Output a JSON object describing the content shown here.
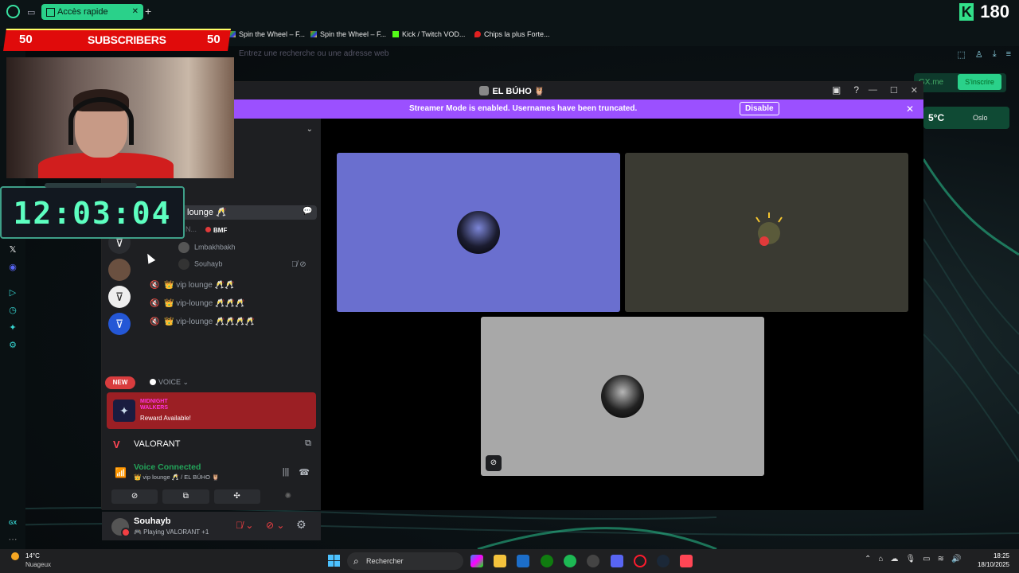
{
  "browser": {
    "tab_label": "Accès rapide",
    "counter": "180",
    "address_placeholder": "Entrez une recherche ou une adresse web",
    "bookmarks": [
      "Spin the Wheel – F...",
      "Spin the Wheel – F...",
      "Kick / Twitch VOD...",
      "Chips la plus Forte..."
    ],
    "gxme": "GX.me",
    "subscribe_label": "S'inscrire",
    "weather_temp": "5°C",
    "weather_city": "Oslo",
    "sidebar_label": "GX"
  },
  "overlay": {
    "subs_left": "50",
    "subs_label": "SUBSCRIBERS",
    "subs_right": "50",
    "timer": "12:03:04"
  },
  "discord": {
    "window_title": "EL BÚHO 🦉",
    "streamer_message": "Streamer Mode is enabled. Usernames have been truncated.",
    "disable_label": "Disable",
    "new_badge": "NEW",
    "active_channel": "lounge 🥂",
    "user_tag_fragment": "N...",
    "bmf_label": "BMF",
    "users": [
      "Lmbakhbakh",
      "Souhayb"
    ],
    "voice_channels": [
      "👑 vip lounge 🥂🥂",
      "👑 vip-lounge 🥂🥂🥂",
      "👑 vip-lounge 🥂🥂🥂🥂"
    ],
    "voice_category": "VOICE",
    "reward_logo": "MIDNIGHT WALKERS",
    "reward_text": "Reward Available!",
    "game_name": "VALORANT",
    "voice_connected": "Voice Connected",
    "voice_location": "👑 vip lounge 🥂 / EL BÚHO 🦉",
    "username": "Souhayb",
    "user_status": "🎮 Playing VALORANT +1"
  },
  "taskbar": {
    "weather_temp": "14°C",
    "weather_cond": "Nuageux",
    "search_label": "Rechercher",
    "time": "18:25",
    "date": "18/10/2025"
  },
  "colors": {
    "accent_green": "#2ad18a",
    "streamer_purple": "#9b50ff",
    "tile1": "#6a6fcf",
    "tile2": "#3a3a32",
    "tile3": "#a8a8a8",
    "voice_green": "#23a55a"
  }
}
